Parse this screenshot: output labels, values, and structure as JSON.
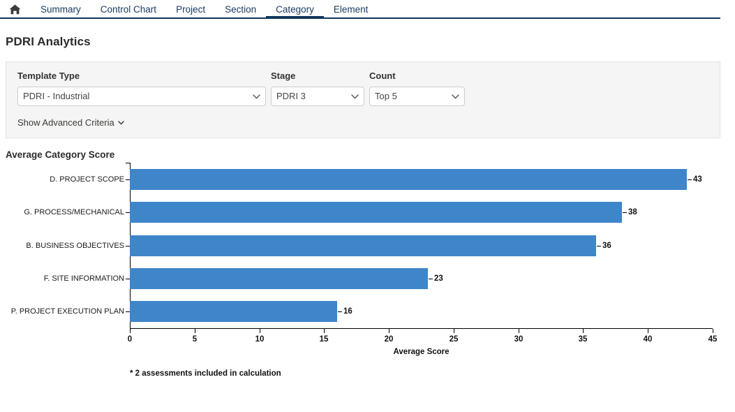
{
  "nav": {
    "home_icon": "home-icon",
    "tabs": [
      {
        "label": "Summary",
        "active": false
      },
      {
        "label": "Control Chart",
        "active": false
      },
      {
        "label": "Project",
        "active": false
      },
      {
        "label": "Section",
        "active": false
      },
      {
        "label": "Category",
        "active": true
      },
      {
        "label": "Element",
        "active": false
      }
    ]
  },
  "page": {
    "title": "PDRI Analytics"
  },
  "filters": {
    "template_type": {
      "label": "Template Type",
      "value": "PDRI - Industrial"
    },
    "stage": {
      "label": "Stage",
      "value": "PDRI 3"
    },
    "count": {
      "label": "Count",
      "value": "Top 5"
    },
    "advanced_link": "Show Advanced Criteria"
  },
  "chart_data": {
    "type": "bar",
    "orientation": "horizontal",
    "title": "Average Category Score",
    "xlabel": "Average Score",
    "ylabel": "",
    "categories": [
      "D. PROJECT SCOPE",
      "G. PROCESS/MECHANICAL",
      "B. BUSINESS OBJECTIVES",
      "F. SITE INFORMATION",
      "P. PROJECT EXECUTION PLAN"
    ],
    "values": [
      43,
      38,
      36,
      23,
      16
    ],
    "xlim": [
      0,
      45
    ],
    "xticks": [
      0,
      5,
      10,
      15,
      20,
      25,
      30,
      35,
      40,
      45
    ],
    "grid": false,
    "legend": null,
    "bar_color": "#3f85ca",
    "footnote": "* 2 assessments included in calculation"
  },
  "colors": {
    "nav_accent": "#10355c",
    "tab_text": "#1b3c63",
    "bar": "#3f85ca",
    "panel_bg": "#f5f5f5"
  }
}
